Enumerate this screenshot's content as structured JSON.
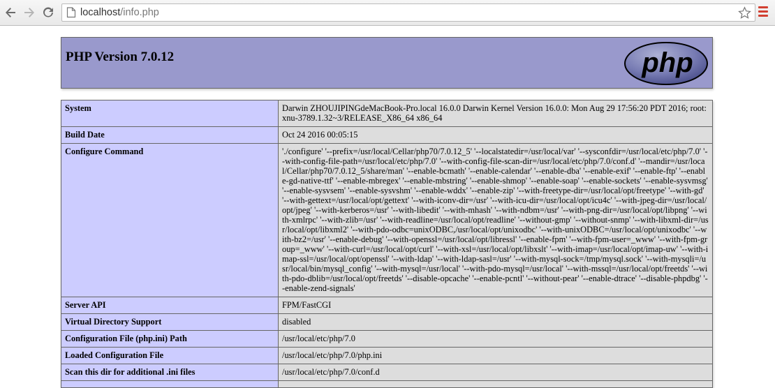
{
  "browser": {
    "url_host": "localhost",
    "url_path": "/info.php",
    "icons": {
      "back": "arrow-left-icon",
      "forward": "arrow-right-icon",
      "reload": "reload-icon",
      "page": "page-icon",
      "bookmark": "star-icon",
      "menu": "hamburger-menu-icon"
    },
    "menu_color": "#d23f31"
  },
  "header": {
    "title": "PHP Version 7.0.12",
    "logo_text": "php",
    "bg_color": "#9999cc"
  },
  "rows": [
    {
      "key": "System",
      "value": "Darwin ZHOUJIPINGdeMacBook-Pro.local 16.0.0 Darwin Kernel Version 16.0.0: Mon Aug 29 17:56:20 PDT 2016; root:xnu-3789.1.32~3/RELEASE_X86_64 x86_64"
    },
    {
      "key": "Build Date",
      "value": "Oct 24 2016 00:05:15"
    },
    {
      "key": "Configure Command",
      "value": "'./configure' '--prefix=/usr/local/Cellar/php70/7.0.12_5' '--localstatedir=/usr/local/var' '--sysconfdir=/usr/local/etc/php/7.0' '--with-config-file-path=/usr/local/etc/php/7.0' '--with-config-file-scan-dir=/usr/local/etc/php/7.0/conf.d' '--mandir=/usr/local/Cellar/php70/7.0.12_5/share/man' '--enable-bcmath' '--enable-calendar' '--enable-dba' '--enable-exif' '--enable-ftp' '--enable-gd-native-ttf' '--enable-mbregex' '--enable-mbstring' '--enable-shmop' '--enable-soap' '--enable-sockets' '--enable-sysvmsg' '--enable-sysvsem' '--enable-sysvshm' '--enable-wddx' '--enable-zip' '--with-freetype-dir=/usr/local/opt/freetype' '--with-gd' '--with-gettext=/usr/local/opt/gettext' '--with-iconv-dir=/usr' '--with-icu-dir=/usr/local/opt/icu4c' '--with-jpeg-dir=/usr/local/opt/jpeg' '--with-kerberos=/usr' '--with-libedit' '--with-mhash' '--with-ndbm=/usr' '--with-png-dir=/usr/local/opt/libpng' '--with-xmlrpc' '--with-zlib=/usr' '--with-readline=/usr/local/opt/readline' '--without-gmp' '--without-snmp' '--with-libxml-dir=/usr/local/opt/libxml2' '--with-pdo-odbc=unixODBC,/usr/local/opt/unixodbc' '--with-unixODBC=/usr/local/opt/unixodbc' '--with-bz2=/usr' '--enable-debug' '--with-openssl=/usr/local/opt/libressl' '--enable-fpm' '--with-fpm-user=_www' '--with-fpm-group=_www' '--with-curl=/usr/local/opt/curl' '--with-xsl=/usr/local/opt/libxslt' '--with-imap=/usr/local/opt/imap-uw' '--with-imap-ssl=/usr/local/opt/openssl' '--with-ldap' '--with-ldap-sasl=/usr' '--with-mysql-sock=/tmp/mysql.sock' '--with-mysqli=/usr/local/bin/mysql_config' '--with-mysql=/usr/local' '--with-pdo-mysql=/usr/local' '--with-mssql=/usr/local/opt/freetds' '--with-pdo-dblib=/usr/local/opt/freetds' '--disable-opcache' '--enable-pcntl' '--without-pear' '--enable-dtrace' '--disable-phpdbg' '--enable-zend-signals'"
    },
    {
      "key": "Server API",
      "value": "FPM/FastCGI"
    },
    {
      "key": "Virtual Directory Support",
      "value": "disabled"
    },
    {
      "key": "Configuration File (php.ini) Path",
      "value": "/usr/local/etc/php/7.0"
    },
    {
      "key": "Loaded Configuration File",
      "value": "/usr/local/etc/php/7.0/php.ini"
    },
    {
      "key": "Scan this dir for additional .ini files",
      "value": "/usr/local/etc/php/7.0/conf.d"
    },
    {
      "key": "",
      "value": ""
    }
  ]
}
